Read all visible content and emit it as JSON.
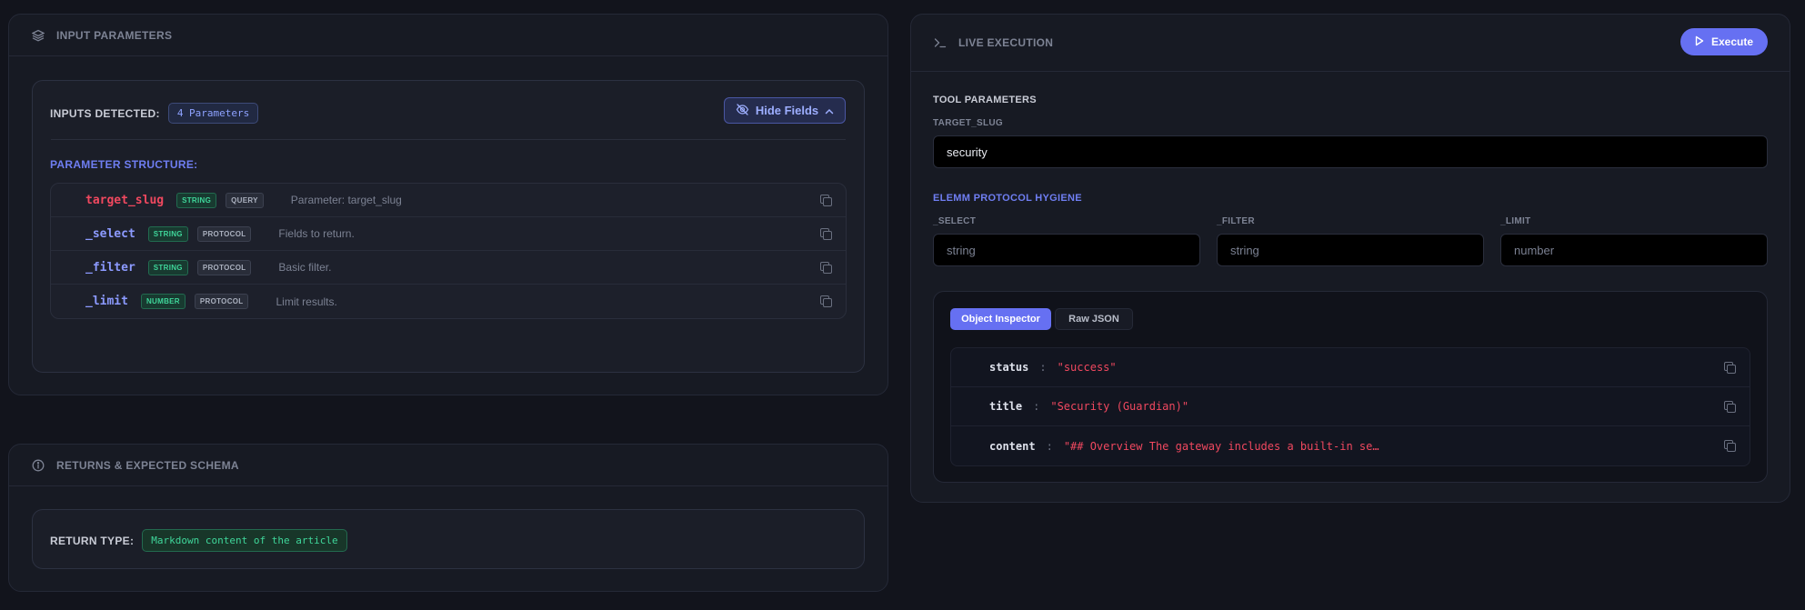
{
  "input_panel": {
    "title": "INPUT PARAMETERS",
    "inputs_detected_label": "INPUTS DETECTED:",
    "inputs_detected_count": "4 Parameters",
    "hide_fields_label": "Hide Fields",
    "structure_title": "PARAMETER STRUCTURE:",
    "params": [
      {
        "name": "target_slug",
        "type": "STRING",
        "location": "QUERY",
        "description": "Parameter: target_slug",
        "required": true
      },
      {
        "name": "_select",
        "type": "STRING",
        "location": "PROTOCOL",
        "description": "Fields to return.",
        "required": false
      },
      {
        "name": "_filter",
        "type": "STRING",
        "location": "PROTOCOL",
        "description": "Basic filter.",
        "required": false
      },
      {
        "name": "_limit",
        "type": "NUMBER",
        "location": "PROTOCOL",
        "description": "Limit results.",
        "required": false
      }
    ]
  },
  "returns_panel": {
    "title": "RETURNS & EXPECTED SCHEMA",
    "return_type_label": "RETURN TYPE:",
    "return_type_value": "Markdown content of the article"
  },
  "execution_panel": {
    "title": "LIVE EXECUTION",
    "execute_label": "Execute",
    "tool_params_title": "TOOL PARAMETERS",
    "target_slug_label": "TARGET_SLUG",
    "target_slug_value": "security",
    "hygiene_title": "ELEMM PROTOCOL HYGIENE",
    "select_label": "_SELECT",
    "select_placeholder": "string",
    "filter_label": "_FILTER",
    "filter_placeholder": "string",
    "limit_label": "_LIMIT",
    "limit_placeholder": "number",
    "tabs": [
      "Object Inspector",
      "Raw JSON"
    ],
    "active_tab": "Object Inspector",
    "result": [
      {
        "key": "status",
        "value": "\"success\""
      },
      {
        "key": "title",
        "value": "\"Security (Guardian)\""
      },
      {
        "key": "content",
        "value": "\"## Overview The gateway includes a built-in se…"
      }
    ]
  },
  "colors": {
    "background": "#12141c",
    "accent": "#6670f2",
    "required_param": "#f0485f",
    "type_tag": "#3fd69a"
  }
}
